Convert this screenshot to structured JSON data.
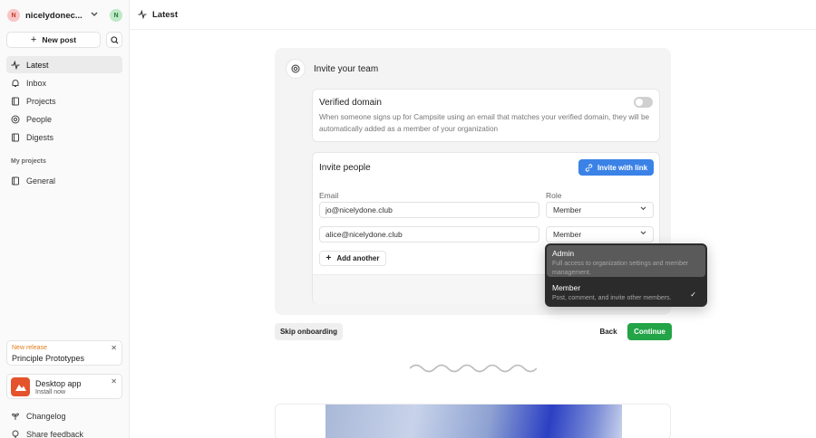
{
  "sidebar": {
    "org": {
      "initial": "N",
      "name": "nicelydonec..."
    },
    "user_initial": "N",
    "new_post_label": "New post",
    "nav": [
      {
        "label": "Latest",
        "icon": "activity-icon",
        "active": true
      },
      {
        "label": "Inbox",
        "icon": "bell-icon"
      },
      {
        "label": "Projects",
        "icon": "book-icon"
      },
      {
        "label": "People",
        "icon": "at-icon"
      },
      {
        "label": "Digests",
        "icon": "newspaper-icon"
      }
    ],
    "projects_section_label": "My projects",
    "projects": [
      {
        "label": "General",
        "icon": "book-icon"
      }
    ],
    "release_card": {
      "tag": "New release",
      "title": "Principle Prototypes"
    },
    "desktop_card": {
      "title": "Desktop app",
      "subtitle": "Install now"
    },
    "footer": [
      {
        "label": "Changelog",
        "icon": "sprout-icon"
      },
      {
        "label": "Share feedback",
        "icon": "lightbulb-icon"
      }
    ]
  },
  "header": {
    "title": "Latest"
  },
  "main": {
    "team_title": "Invite your team",
    "verified_domain": {
      "title": "Verified domain",
      "description": "When someone signs up for Campsite using an email that matches your verified domain, they will be automatically added as a member of your organization",
      "enabled": false
    },
    "invite": {
      "title": "Invite people",
      "invite_link_label": "Invite with link",
      "email_label": "Email",
      "role_label": "Role",
      "rows": [
        {
          "email": "jo@nicelydone.club",
          "role": "Member"
        },
        {
          "email": "alice@nicelydone.club",
          "role": "Member"
        }
      ],
      "add_another_label": "Add another"
    },
    "role_dropdown": {
      "options": [
        {
          "title": "Admin",
          "description": "Full access to organization settings and member management.",
          "highlighted": true,
          "selected": false
        },
        {
          "title": "Member",
          "description": "Post, comment, and invite other members.",
          "highlighted": false,
          "selected": true
        }
      ]
    },
    "actions": {
      "skip": "Skip onboarding",
      "back": "Back",
      "continue": "Continue"
    }
  },
  "colors": {
    "accent_blue": "#3b82e6",
    "continue_green": "#23a447",
    "release_orange": "#e07b1a"
  }
}
